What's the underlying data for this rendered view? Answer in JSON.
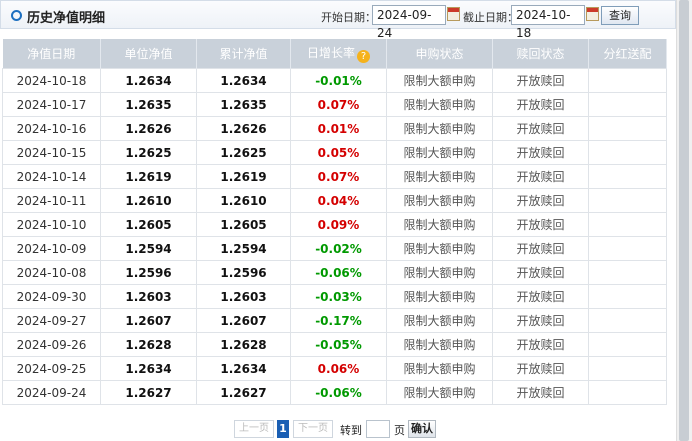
{
  "header": {
    "title": "历史净值明细",
    "start_label": "开始日期：",
    "start_date": "2024-09-24",
    "end_label": "截止日期：",
    "end_date": "2024-10-18",
    "query_label": "查询"
  },
  "table": {
    "columns": [
      "净值日期",
      "单位净值",
      "累计净值",
      "日增长率",
      "申购状态",
      "赎回状态",
      "分红送配"
    ],
    "rows": [
      {
        "date": "2024-10-18",
        "unit": "1.2634",
        "acc": "1.2634",
        "growth": "-0.01%",
        "dir": "down",
        "buy": "限制大额申购",
        "redeem": "开放赎回",
        "dividend": ""
      },
      {
        "date": "2024-10-17",
        "unit": "1.2635",
        "acc": "1.2635",
        "growth": "0.07%",
        "dir": "up",
        "buy": "限制大额申购",
        "redeem": "开放赎回",
        "dividend": ""
      },
      {
        "date": "2024-10-16",
        "unit": "1.2626",
        "acc": "1.2626",
        "growth": "0.01%",
        "dir": "up",
        "buy": "限制大额申购",
        "redeem": "开放赎回",
        "dividend": ""
      },
      {
        "date": "2024-10-15",
        "unit": "1.2625",
        "acc": "1.2625",
        "growth": "0.05%",
        "dir": "up",
        "buy": "限制大额申购",
        "redeem": "开放赎回",
        "dividend": ""
      },
      {
        "date": "2024-10-14",
        "unit": "1.2619",
        "acc": "1.2619",
        "growth": "0.07%",
        "dir": "up",
        "buy": "限制大额申购",
        "redeem": "开放赎回",
        "dividend": ""
      },
      {
        "date": "2024-10-11",
        "unit": "1.2610",
        "acc": "1.2610",
        "growth": "0.04%",
        "dir": "up",
        "buy": "限制大额申购",
        "redeem": "开放赎回",
        "dividend": ""
      },
      {
        "date": "2024-10-10",
        "unit": "1.2605",
        "acc": "1.2605",
        "growth": "0.09%",
        "dir": "up",
        "buy": "限制大额申购",
        "redeem": "开放赎回",
        "dividend": ""
      },
      {
        "date": "2024-10-09",
        "unit": "1.2594",
        "acc": "1.2594",
        "growth": "-0.02%",
        "dir": "down",
        "buy": "限制大额申购",
        "redeem": "开放赎回",
        "dividend": ""
      },
      {
        "date": "2024-10-08",
        "unit": "1.2596",
        "acc": "1.2596",
        "growth": "-0.06%",
        "dir": "down",
        "buy": "限制大额申购",
        "redeem": "开放赎回",
        "dividend": ""
      },
      {
        "date": "2024-09-30",
        "unit": "1.2603",
        "acc": "1.2603",
        "growth": "-0.03%",
        "dir": "down",
        "buy": "限制大额申购",
        "redeem": "开放赎回",
        "dividend": ""
      },
      {
        "date": "2024-09-27",
        "unit": "1.2607",
        "acc": "1.2607",
        "growth": "-0.17%",
        "dir": "down",
        "buy": "限制大额申购",
        "redeem": "开放赎回",
        "dividend": ""
      },
      {
        "date": "2024-09-26",
        "unit": "1.2628",
        "acc": "1.2628",
        "growth": "-0.05%",
        "dir": "down",
        "buy": "限制大额申购",
        "redeem": "开放赎回",
        "dividend": ""
      },
      {
        "date": "2024-09-25",
        "unit": "1.2634",
        "acc": "1.2634",
        "growth": "0.06%",
        "dir": "up",
        "buy": "限制大额申购",
        "redeem": "开放赎回",
        "dividend": ""
      },
      {
        "date": "2024-09-24",
        "unit": "1.2627",
        "acc": "1.2627",
        "growth": "-0.06%",
        "dir": "down",
        "buy": "限制大额申购",
        "redeem": "开放赎回",
        "dividend": ""
      }
    ]
  },
  "pager": {
    "prev_label": "上一页",
    "current_page": "1",
    "next_label": "下一页",
    "goto_label": "转到",
    "page_unit": "页",
    "confirm_label": "确认"
  },
  "colors": {
    "up": "#d40000",
    "down": "#009900",
    "header_bg": "#c9d1da",
    "accent": "#1a5fb4"
  },
  "icons": {
    "help": "question-circle-icon",
    "calendar": "calendar-icon",
    "title_marker": "circle-marker-icon"
  }
}
